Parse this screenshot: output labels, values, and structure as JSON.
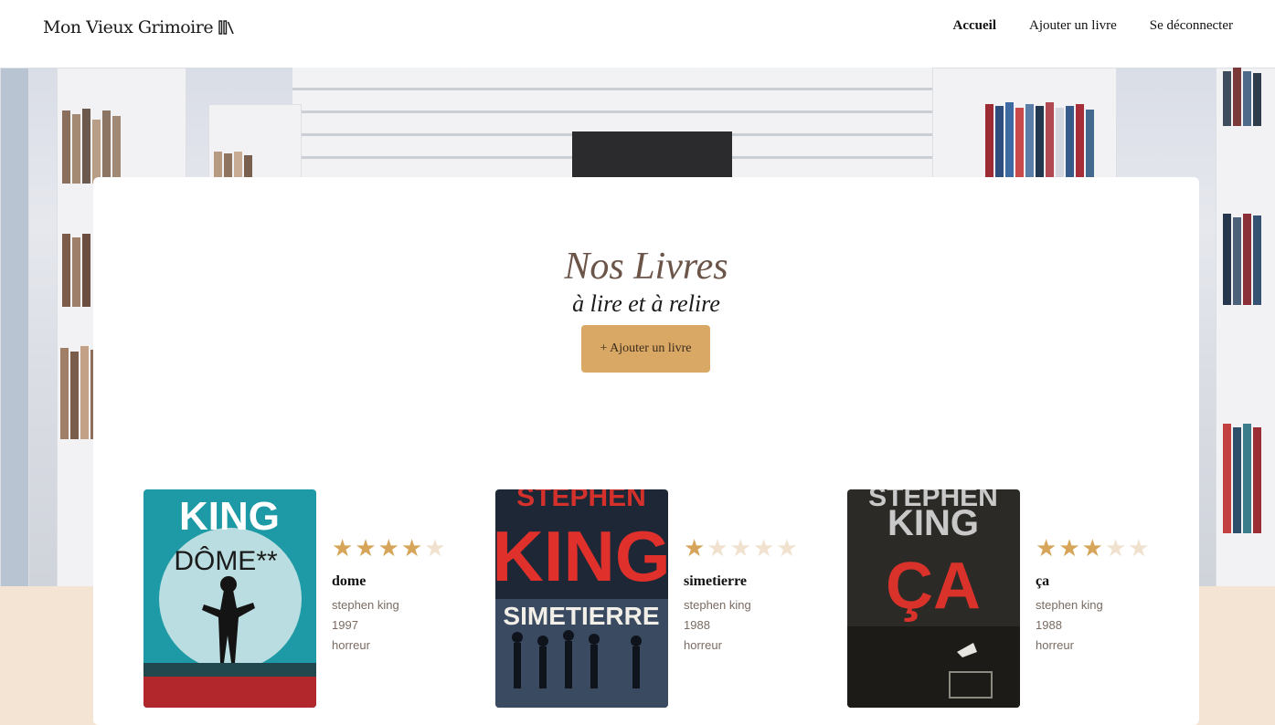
{
  "header": {
    "brand": "Mon Vieux Grimoire",
    "nav": [
      {
        "label": "Accueil",
        "active": true
      },
      {
        "label": "Ajouter un livre",
        "active": false
      },
      {
        "label": "Se déconnecter",
        "active": false
      }
    ]
  },
  "main": {
    "title": "Nos Livres",
    "subtitle": "à lire et à relire",
    "add_button": "+ Ajouter un livre"
  },
  "books": [
    {
      "title": "dome",
      "author": "stephen king",
      "year": "1997",
      "genre": "horreur",
      "rating": 4,
      "cover": {
        "line1": "KING",
        "line2": "DÔME**",
        "bg": "#1d9aa6"
      }
    },
    {
      "title": "simetierre",
      "author": "stephen king",
      "year": "1988",
      "genre": "horreur",
      "rating": 1,
      "cover": {
        "line1": "STEPHEN",
        "line2": "KING",
        "line3": "SIMETIERRE",
        "bg": "#1e2735"
      }
    },
    {
      "title": "ça",
      "author": "stephen king",
      "year": "1988",
      "genre": "horreur",
      "rating": 3,
      "cover": {
        "line1": "STEPHEN",
        "line2": "KING",
        "line3": "ÇA",
        "bg": "#2b2a26"
      }
    }
  ],
  "colors": {
    "accent": "#d9a865",
    "star_on": "#d6a559",
    "star_off": "#f0e2cf",
    "title": "#6b5448"
  }
}
